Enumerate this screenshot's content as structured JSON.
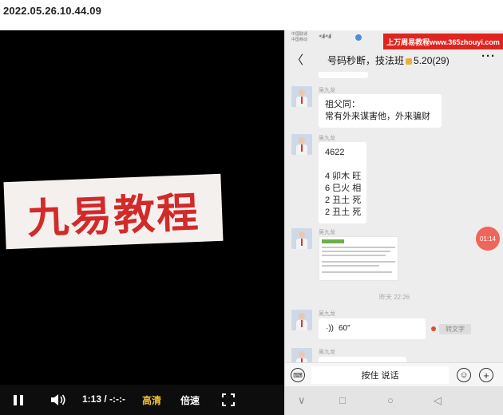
{
  "timestamp": "2022.05.26.10.44.09",
  "video": {
    "watermark": "九易教程",
    "controls": {
      "time": "1:13 / -:-:-",
      "quality": "高清",
      "speed": "倍速"
    },
    "icons": {
      "pause": "pause-icon",
      "volume": "volume-icon",
      "fullscreen": "fullscreen-icon"
    }
  },
  "phone": {
    "status": {
      "carrier1": "中国联通",
      "carrier2": "中国移动",
      "signal": "⁴⁶.ıll ⁴⁶.ıll",
      "banner": "上万周易教程www.365zhouyi.com"
    },
    "nav": {
      "back": "〈",
      "title": "号码秒断，技法班",
      "title_suffix": "5.20(29)",
      "more": "···"
    },
    "messages": [
      {
        "sender": "吴九龙",
        "lines": [
          "祖父同：",
          "常有外来谋害他，外来骗财"
        ]
      },
      {
        "sender": "吴九龙",
        "lines": [
          "4622",
          "",
          "4 卯木 旺",
          "6 巳火 相",
          "2 丑土 死",
          "2 丑土 死"
        ]
      },
      {
        "sender": "吴九龙",
        "image": true
      },
      {
        "sender": "吴九龙",
        "voice": "60\""
      },
      {
        "sender": "吴九龙"
      }
    ],
    "time_divider": "昨天 22:26",
    "voice_wave": "·))",
    "convert_pill": "转文字",
    "float_clock": "01:14",
    "input": {
      "hold_to_talk": "按住 说话"
    },
    "sysnav": [
      "∨",
      "□",
      "○",
      "◁"
    ]
  }
}
